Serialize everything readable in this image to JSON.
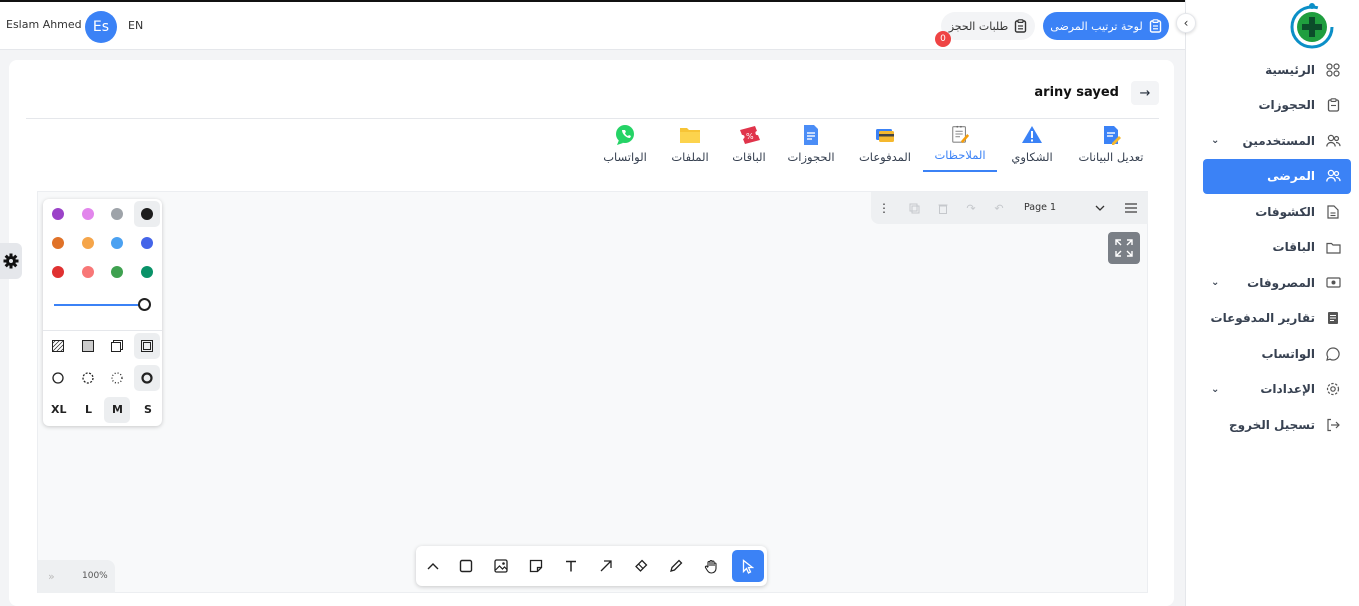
{
  "header": {
    "user_name": "Eslam Ahmed",
    "avatar_initials": "Es",
    "lang": "EN",
    "queue_button": "لوحة ترتيب المرضى",
    "requests_button": "طلبات الحجز",
    "requests_count": "0"
  },
  "sidebar": {
    "items": [
      {
        "label": "الرئيسية",
        "icon": "grid-icon"
      },
      {
        "label": "الحجوزات",
        "icon": "clipboard-icon"
      },
      {
        "label": "المستخدمين",
        "icon": "users-icon",
        "expandable": true
      },
      {
        "label": "المرضى",
        "icon": "patients-icon",
        "active": true
      },
      {
        "label": "الكشوفات",
        "icon": "document-icon"
      },
      {
        "label": "الباقات",
        "icon": "folder-icon"
      },
      {
        "label": "المصروفات",
        "icon": "money-icon",
        "expandable": true
      },
      {
        "label": "تقارير المدفوعات",
        "icon": "report-icon"
      },
      {
        "label": "الواتساب",
        "icon": "whatsapp-icon"
      },
      {
        "label": "الإعدادات",
        "icon": "settings-icon",
        "expandable": true
      },
      {
        "label": "تسجيل الخروج",
        "icon": "logout-icon"
      }
    ]
  },
  "patient": {
    "name": "ariny sayed"
  },
  "tabs": [
    {
      "label": "تعديل البيانات",
      "icon": "edit-data-icon"
    },
    {
      "label": "الشكاوي",
      "icon": "warning-icon"
    },
    {
      "label": "الملاحظات",
      "icon": "notes-icon",
      "active": true
    },
    {
      "label": "المدفوعات",
      "icon": "card-icon"
    },
    {
      "label": "الحجوزات",
      "icon": "doc-icon"
    },
    {
      "label": "الباقات",
      "icon": "ticket-icon"
    },
    {
      "label": "الملفات",
      "icon": "folder-icon"
    },
    {
      "label": "الواتساب",
      "icon": "whatsapp-icon"
    }
  ],
  "whiteboard": {
    "page_label": "Page 1",
    "zoom": "100%",
    "colors": [
      "#9b42c8",
      "#e286ec",
      "#9ea3a9",
      "#1d1d1d",
      "#e07228",
      "#f5a54a",
      "#4ba1f1",
      "#4465e9",
      "#e03131",
      "#f87777",
      "#3fa150",
      "#099268"
    ],
    "selected_color": "#1d1d1d",
    "sizes": [
      "XL",
      "L",
      "M",
      "S"
    ],
    "selected_size": "M",
    "tools": [
      "chevron-up-icon",
      "rectangle-icon",
      "image-icon",
      "note-icon",
      "text-icon",
      "arrow-icon",
      "eraser-icon",
      "pencil-icon",
      "hand-icon",
      "select-icon"
    ],
    "active_tool": "select-icon"
  }
}
